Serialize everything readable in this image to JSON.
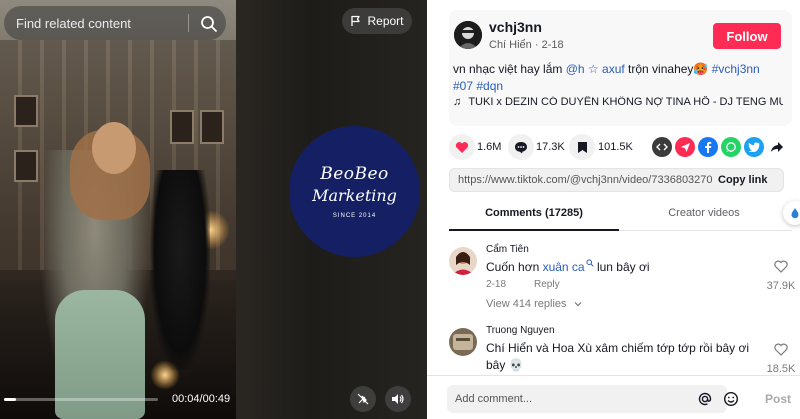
{
  "video": {
    "search_placeholder": "Find related content",
    "report_label": "Report",
    "time": "00:04/00:49",
    "progress": 0.08,
    "logo": {
      "line1": "BeoBeo",
      "line2": "Marketing",
      "line3": "SINCE 2014"
    },
    "colors": {
      "logo_bg": "#142063"
    }
  },
  "post": {
    "username": "vchj3nn",
    "display_name": "Chí Hiển",
    "date": "2-18",
    "follow_label": "Follow",
    "desc_prefix": "vn nhạc việt hay lắm ",
    "desc_mention": "@h ☆ axuf",
    "desc_mid": " trộn vinahey🥵 ",
    "desc_tags": [
      "#vchj3nn",
      "#07",
      "#dqn"
    ],
    "music": "TUKI x DEZIN CÓ DUYÊN KHÔNG NỢ TINA HỒ - DJ TENG MUZIC ...",
    "colors": {
      "accent": "#fe2c55",
      "hashtag": "#2b5db9"
    }
  },
  "actions": {
    "likes": "1.6M",
    "comments": "17.3K",
    "saves": "101.5K"
  },
  "link": {
    "url": "https://www.tiktok.com/@vchj3nn/video/7336803270...",
    "copy_label": "Copy link"
  },
  "tabs": {
    "comments": "Comments (17285)",
    "creator": "Creator videos"
  },
  "comments": [
    {
      "name": "Cẩm Tiên",
      "text_pre": "Cuốn hơn ",
      "keyword": "xuân ca",
      "text_post": " lun bây ơi",
      "date": "2-18",
      "reply_label": "Reply",
      "likes": "37.9K",
      "view_replies": "View 414 replies"
    },
    {
      "name": "Truong Nguyen",
      "text": "Chí Hiển và Hoa Xù xâm chiếm tớp tớp rồi bây ơi bây 💀",
      "likes": "18.5K"
    }
  ],
  "comment_bar": {
    "placeholder": "Add comment...",
    "post_label": "Post"
  },
  "icons": [
    "search-icon",
    "flag-icon",
    "speaker-icon",
    "float-mode-icon",
    "heart-icon",
    "comment-icon",
    "bookmark-icon",
    "embed-icon",
    "send-icon",
    "facebook-icon",
    "whatsapp-icon",
    "twitter-icon",
    "share-arrow-icon",
    "music-note-icon",
    "at-icon",
    "emoji-icon"
  ]
}
